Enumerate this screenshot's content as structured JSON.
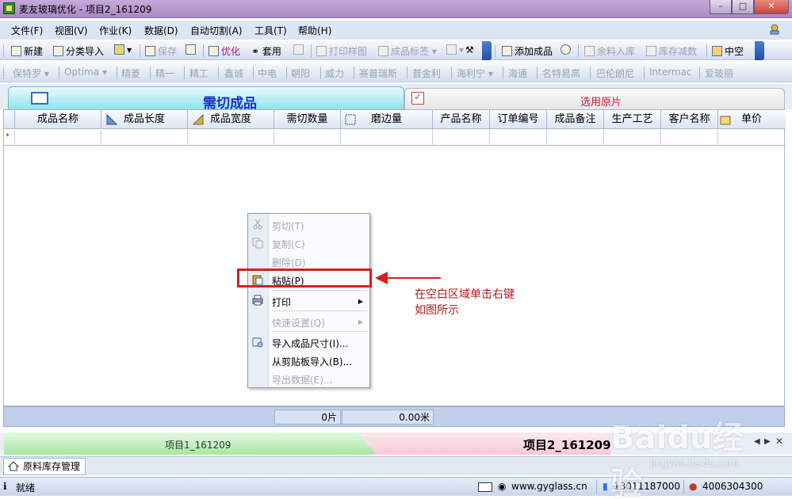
{
  "window": {
    "title": "麦友玻璃优化 - 项目2_161209"
  },
  "menu": [
    "文件(F)",
    "视图(V)",
    "作业(K)",
    "数据(D)",
    "自动切割(A)",
    "工具(T)",
    "帮助(H)"
  ],
  "toolbar1": {
    "new": "新建",
    "import": "分类导入",
    "save": "保存",
    "optimize": "优化",
    "apply": "套用",
    "print_sample": "打印样图",
    "product_label": "成品标签",
    "add_product": "添加成品",
    "surplus_in": "余料入库",
    "stock_reduce": "库存减数",
    "hollow": "中空"
  },
  "toolbar2": [
    "保特罗",
    "Optima",
    "精菱",
    "精一",
    "精工",
    "鑫诚",
    "中电",
    "朝阳",
    "威力",
    "赛普瑞斯",
    "普金利",
    "海利宁",
    "海通",
    "名特易高",
    "巴伦朗尼",
    "Intermac",
    "爱玻丽"
  ],
  "tabs": {
    "left": "需切成品",
    "right": "选用原片"
  },
  "columns": [
    "成品名称",
    "成品长度",
    "成品宽度",
    "需切数量",
    "磨边量",
    "产品名称",
    "订单编号",
    "成品备注",
    "生产工艺",
    "客户名称",
    "单价"
  ],
  "new_row_marker": "*",
  "summary": {
    "pieces": "0片",
    "meters": "0.00米"
  },
  "context_menu": {
    "cut": "剪切(T)",
    "copy": "复制(C)",
    "delete": "删除(D)",
    "paste": "粘贴(P)",
    "print": "打印",
    "quick_settings": "快速设置(Q)",
    "import_sizes": "导入成品尺寸(I)...",
    "import_clipboard": "从剪贴板导入(B)...",
    "export": "导出数据(E)..."
  },
  "annotation": {
    "line1": "在空白区域单击右键",
    "line2": "如图所示"
  },
  "projects": {
    "p1": "项目1_161209",
    "p2": "项目2_161209"
  },
  "bottom_tab": "原料库存管理",
  "status": {
    "ready": "就绪",
    "website": "www.gyglass.cn",
    "mobile": "13011187000",
    "phone": "4006304300"
  },
  "watermark": {
    "text": "Baidu经验",
    "sub": "jingyan.baidu.com"
  },
  "colors": {
    "highlight": "#d42020",
    "tab_title": "#1a2fc9",
    "tab_right": "#c5223a"
  }
}
